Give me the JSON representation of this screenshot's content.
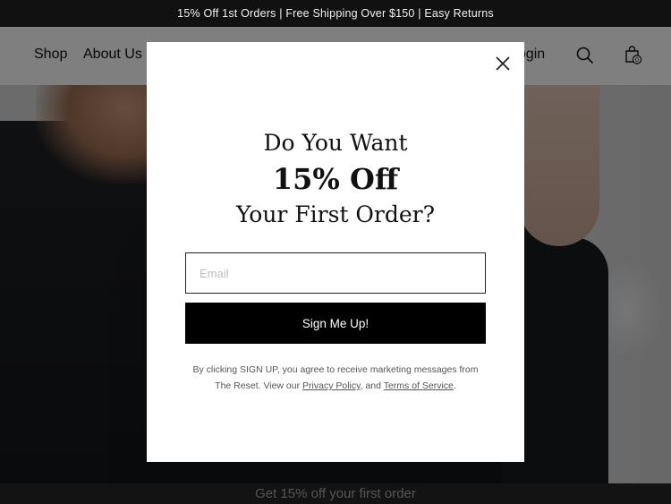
{
  "announcement": "15% Off 1st Orders | Free Shipping Over $150 | Easy Returns",
  "header": {
    "nav": {
      "shop": "Shop",
      "about": "About Us",
      "login": "Login"
    },
    "cart_count": "0"
  },
  "popup": {
    "line1": "Do You Want",
    "line2": "15% Off",
    "line3": "Your First Order?",
    "email_placeholder": "Email",
    "email_value": "",
    "submit_label": "Sign Me Up!",
    "legal_prefix": "By clicking SIGN UP,  you agree to receive marketing messages from The Reset. View our ",
    "privacy_link": "Privacy Policy",
    "legal_and": ", and ",
    "terms_link": "Terms of Service",
    "legal_suffix": "."
  },
  "bottom_bar": "Get 15% off your first order",
  "icons": {
    "close": "close-icon",
    "search": "search-icon",
    "cart": "shopping-bag-icon"
  }
}
